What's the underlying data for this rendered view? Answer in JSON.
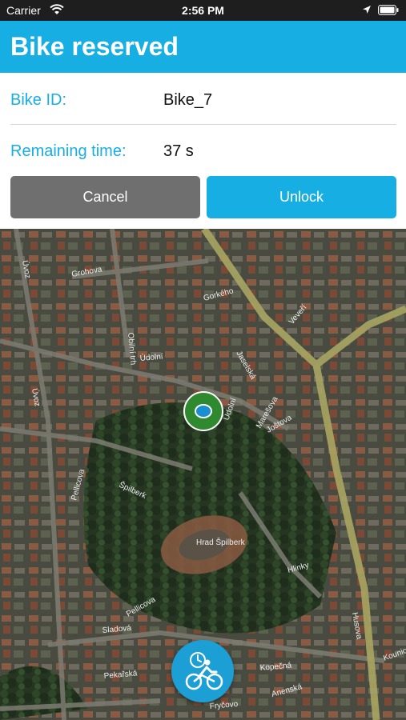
{
  "status_bar": {
    "carrier": "Carrier",
    "time": "2:56 PM",
    "icons": [
      "wifi-icon",
      "location-arrow-icon",
      "battery-icon"
    ]
  },
  "header": {
    "title": "Bike reserved"
  },
  "reservation": {
    "bike_id_label": "Bike ID:",
    "bike_id_value": "Bike_7",
    "remaining_label": "Remaining time:",
    "remaining_value": "37 s"
  },
  "actions": {
    "cancel_label": "Cancel",
    "unlock_label": "Unlock"
  },
  "map": {
    "street_labels": [
      "Úvoz",
      "Grohova",
      "Gorkého",
      "Veveří",
      "Údolní",
      "Obilní trh",
      "Jaselská",
      "Marešova",
      "Joštova",
      "Úvoz",
      "Údolní",
      "Pellicova",
      "Špilberk",
      "Hrad Špilberk",
      "Husova",
      "Hlinky",
      "Sladová",
      "Pellicova",
      "Pekařská",
      "Kopečná",
      "Anenská",
      "Fryčovo",
      "Kounicova"
    ],
    "marker_icon": "bike-marker-icon",
    "fab_icon": "cyclist-timer-icon"
  },
  "colors": {
    "accent": "#17aee3",
    "cancel": "#6f6f6f",
    "status_bar": "#1e1e1e"
  }
}
